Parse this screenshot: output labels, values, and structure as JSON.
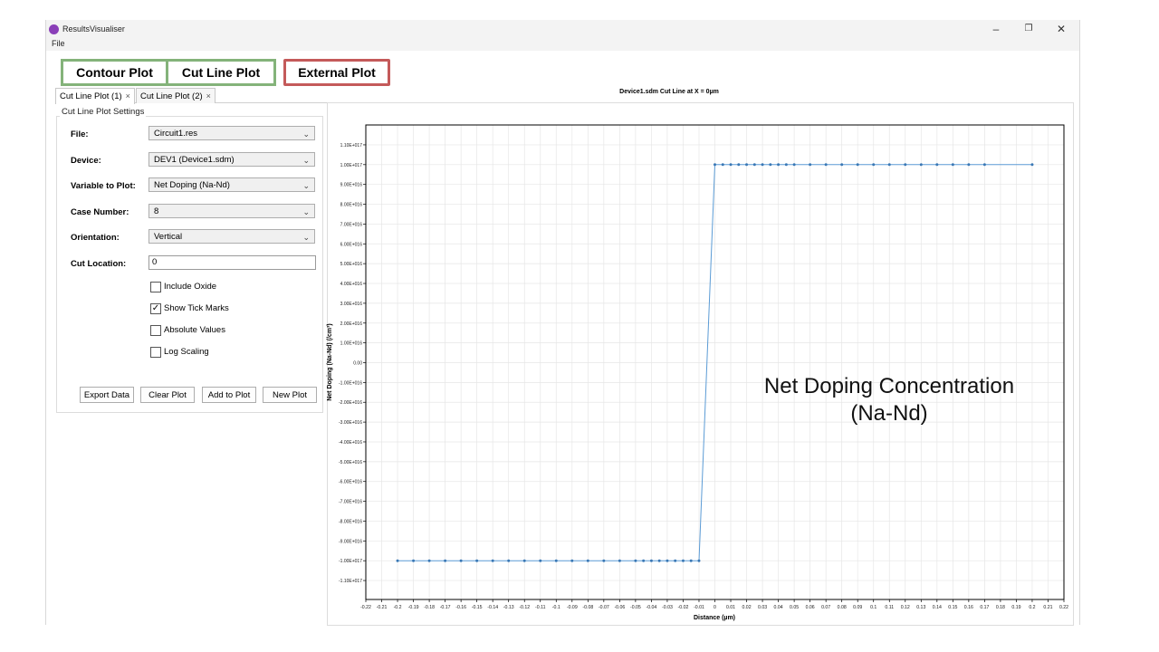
{
  "window": {
    "title": "ResultsVisualiser",
    "controls": {
      "minimize": "–",
      "restore": "❐",
      "close": "✕"
    }
  },
  "menu": {
    "file": "File"
  },
  "view_tabs": {
    "contour": "Contour Plot",
    "cutline": "Cut Line Plot",
    "external": "External Plot",
    "green_border": "#84b37a",
    "red_border": "#c45a5a"
  },
  "doc_tabs": [
    {
      "label": "Cut Line Plot (1)",
      "close": "×"
    },
    {
      "label": "Cut Line Plot (2)",
      "close": "×"
    }
  ],
  "settings": {
    "title": "Cut Line Plot Settings",
    "file": {
      "label": "File:",
      "value": "Circuit1.res"
    },
    "device": {
      "label": "Device:",
      "value": "DEV1 (Device1.sdm)"
    },
    "variable": {
      "label": "Variable to Plot:",
      "value": "Net Doping (Na-Nd)"
    },
    "case": {
      "label": "Case Number:",
      "value": "8"
    },
    "orientation": {
      "label": "Orientation:",
      "value": "Vertical"
    },
    "cut_location": {
      "label": "Cut Location:",
      "value": "0"
    },
    "checkboxes": [
      {
        "label": "Include Oxide",
        "checked": false
      },
      {
        "label": "Show Tick Marks",
        "checked": true
      },
      {
        "label": "Absolute Values",
        "checked": false
      },
      {
        "label": "Log Scaling",
        "checked": false
      }
    ],
    "buttons": {
      "export": "Export Data",
      "clear": "Clear Plot",
      "add": "Add to Plot",
      "new": "New Plot"
    }
  },
  "annotation": {
    "line1": "Net Doping Concentration",
    "line2": "(Na-Nd)"
  },
  "chart_data": {
    "type": "line",
    "title": "Device1.sdm Cut Line at X = 0µm",
    "xlabel": "Distance (µm)",
    "ylabel": "Net Doping (Na-Nd) (/cm³)",
    "xlim": [
      -0.22,
      0.22
    ],
    "ylim": [
      -1.15e+17,
      1.15e+17
    ],
    "x_ticks": [
      -0.22,
      -0.21,
      -0.2,
      -0.19,
      -0.18,
      -0.17,
      -0.16,
      -0.15,
      -0.14,
      -0.13,
      -0.12,
      -0.11,
      -0.1,
      -0.09,
      -0.08,
      -0.07,
      -0.06,
      -0.05,
      -0.04,
      -0.03,
      -0.02,
      -0.01,
      0,
      0.01,
      0.02,
      0.03,
      0.04,
      0.05,
      0.06,
      0.07,
      0.08,
      0.09,
      0.1,
      0.11,
      0.12,
      0.13,
      0.14,
      0.15,
      0.16,
      0.17,
      0.18,
      0.19,
      0.2,
      0.21,
      0.22
    ],
    "x_tick_labels": [
      "-0.22",
      "-0.21",
      "-0.2",
      "-0.19",
      "-0.18",
      "-0.17",
      "-0.16",
      "-0.15",
      "-0.14",
      "-0.13",
      "-0.12",
      "-0.11",
      "-0.1",
      "-0.09",
      "-0.08",
      "-0.07",
      "-0.06",
      "-0.05",
      "-0.04",
      "-0.03",
      "-0.02",
      "-0.01",
      "0",
      "0.01",
      "0.02",
      "0.03",
      "0.04",
      "0.05",
      "0.06",
      "0.07",
      "0.08",
      "0.09",
      "0.1",
      "0.11",
      "0.12",
      "0.13",
      "0.14",
      "0.15",
      "0.16",
      "0.17",
      "0.18",
      "0.19",
      "0.2",
      "0.21",
      "0.22"
    ],
    "y_ticks": [
      1.1e+17,
      1e+17,
      9e+16,
      8e+16,
      7e+16,
      6e+16,
      5e+16,
      4e+16,
      3e+16,
      2e+16,
      1e+16,
      0,
      -1e+16,
      -2e+16,
      -3e+16,
      -4e+16,
      -5e+16,
      -6e+16,
      -7e+16,
      -8e+16,
      -9e+16,
      -1e+17,
      -1.1e+17
    ],
    "y_tick_labels": [
      "1.10E+017",
      "1.00E+017",
      "9.00E+016",
      "8.00E+016",
      "7.00E+016",
      "6.00E+016",
      "5.00E+016",
      "4.00E+016",
      "3.00E+016",
      "2.00E+016",
      "1.00E+016",
      "0.00",
      "-1.00E+016",
      "-2.00E+016",
      "-3.00E+016",
      "-4.00E+016",
      "-5.00E+016",
      "-6.00E+016",
      "-7.00E+016",
      "-8.00E+016",
      "-9.00E+016",
      "-1.00E+017",
      "-1.10E+017"
    ],
    "grid": true,
    "series": [
      {
        "color": "#5b9bd5",
        "x": [
          -0.2,
          -0.19,
          -0.18,
          -0.17,
          -0.16,
          -0.15,
          -0.14,
          -0.13,
          -0.12,
          -0.11,
          -0.1,
          -0.09,
          -0.08,
          -0.07,
          -0.06,
          -0.05,
          -0.045,
          -0.04,
          -0.035,
          -0.03,
          -0.025,
          -0.02,
          -0.015,
          -0.01,
          0,
          0.005,
          0.01,
          0.015,
          0.02,
          0.025,
          0.03,
          0.035,
          0.04,
          0.045,
          0.05,
          0.06,
          0.07,
          0.08,
          0.09,
          0.1,
          0.11,
          0.12,
          0.13,
          0.14,
          0.15,
          0.16,
          0.17,
          0.2
        ],
        "y": [
          -1e+17,
          -1e+17,
          -1e+17,
          -1e+17,
          -1e+17,
          -1e+17,
          -1e+17,
          -1e+17,
          -1e+17,
          -1e+17,
          -1e+17,
          -1e+17,
          -1e+17,
          -1e+17,
          -1e+17,
          -1e+17,
          -1e+17,
          -1e+17,
          -1e+17,
          -1e+17,
          -1e+17,
          -1e+17,
          -1e+17,
          -1e+17,
          1e+17,
          1e+17,
          1e+17,
          1e+17,
          1e+17,
          1e+17,
          1e+17,
          1e+17,
          1e+17,
          1e+17,
          1e+17,
          1e+17,
          1e+17,
          1e+17,
          1e+17,
          1e+17,
          1e+17,
          1e+17,
          1e+17,
          1e+17,
          1e+17,
          1e+17,
          1e+17,
          1e+17
        ]
      }
    ]
  }
}
